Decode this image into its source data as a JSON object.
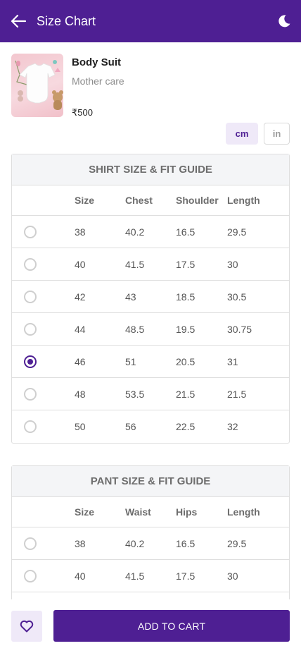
{
  "header": {
    "title": "Size Chart",
    "back_icon": "arrow-left-icon",
    "theme_icon": "moon-icon"
  },
  "product": {
    "name": "Body Suit",
    "brand": "Mother care",
    "price": "₹500",
    "image_icon": "baby-bodysuit-image"
  },
  "units": {
    "cm": "cm",
    "in": "in",
    "selected": "cm"
  },
  "shirt": {
    "title": "SHIRT SIZE & FIT GUIDE",
    "headers": [
      "Size",
      "Chest",
      "Shoulder",
      "Length"
    ],
    "rows": [
      {
        "values": [
          "38",
          "40.2",
          "16.5",
          "29.5"
        ],
        "selected": false
      },
      {
        "values": [
          "40",
          "41.5",
          "17.5",
          "30"
        ],
        "selected": false
      },
      {
        "values": [
          "42",
          "43",
          "18.5",
          "30.5"
        ],
        "selected": false
      },
      {
        "values": [
          "44",
          "48.5",
          "19.5",
          "30.75"
        ],
        "selected": false
      },
      {
        "values": [
          "46",
          "51",
          "20.5",
          "31"
        ],
        "selected": true
      },
      {
        "values": [
          "48",
          "53.5",
          "21.5",
          "21.5"
        ],
        "selected": false
      },
      {
        "values": [
          "50",
          "56",
          "22.5",
          "32"
        ],
        "selected": false
      }
    ]
  },
  "pant": {
    "title": "PANT SIZE & FIT GUIDE",
    "headers": [
      "Size",
      "Waist",
      "Hips",
      "Length"
    ],
    "rows": [
      {
        "values": [
          "38",
          "40.2",
          "16.5",
          "29.5"
        ],
        "selected": false
      },
      {
        "values": [
          "40",
          "41.5",
          "17.5",
          "30"
        ],
        "selected": false
      },
      {
        "values": [
          "",
          "",
          "",
          ""
        ],
        "selected": false
      }
    ]
  },
  "footer": {
    "add_to_cart": "ADD TO CART",
    "wishlist_icon": "heart-icon"
  },
  "colors": {
    "primary": "#4e1f93",
    "primary_light": "#efe9f8"
  }
}
